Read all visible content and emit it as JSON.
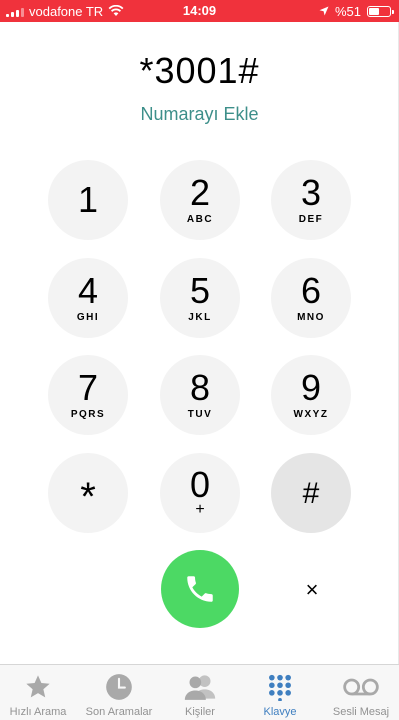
{
  "status_bar": {
    "carrier": "vodafone TR",
    "time": "14:09",
    "battery_text": "%51",
    "battery_level": 0.51,
    "background_color": "#f0323c"
  },
  "dialer": {
    "entered_number": "*3001#",
    "add_number_label": "Numarayı Ekle",
    "keys": [
      {
        "digit": "1",
        "letters": ""
      },
      {
        "digit": "2",
        "letters": "ABC"
      },
      {
        "digit": "3",
        "letters": "DEF"
      },
      {
        "digit": "4",
        "letters": "GHI"
      },
      {
        "digit": "5",
        "letters": "JKL"
      },
      {
        "digit": "6",
        "letters": "MNO"
      },
      {
        "digit": "7",
        "letters": "PQRS"
      },
      {
        "digit": "8",
        "letters": "TUV"
      },
      {
        "digit": "9",
        "letters": "WXYZ"
      },
      {
        "digit": "*",
        "letters": ""
      },
      {
        "digit": "0",
        "letters": "+"
      },
      {
        "digit": "#",
        "letters": ""
      }
    ],
    "call_icon": "phone-icon",
    "call_color": "#4cd964",
    "delete_symbol": "×"
  },
  "tab_bar": {
    "tabs": [
      {
        "label": "Hızlı Arama",
        "icon": "star-icon"
      },
      {
        "label": "Son Aramalar",
        "icon": "clock-icon"
      },
      {
        "label": "Kişiler",
        "icon": "contacts-icon"
      },
      {
        "label": "Klavye",
        "icon": "keypad-icon"
      },
      {
        "label": "Sesli Mesaj",
        "icon": "voicemail-icon"
      }
    ],
    "active_tab": "Klavye",
    "active_color": "#3f7fc0",
    "inactive_color": "#929292"
  }
}
